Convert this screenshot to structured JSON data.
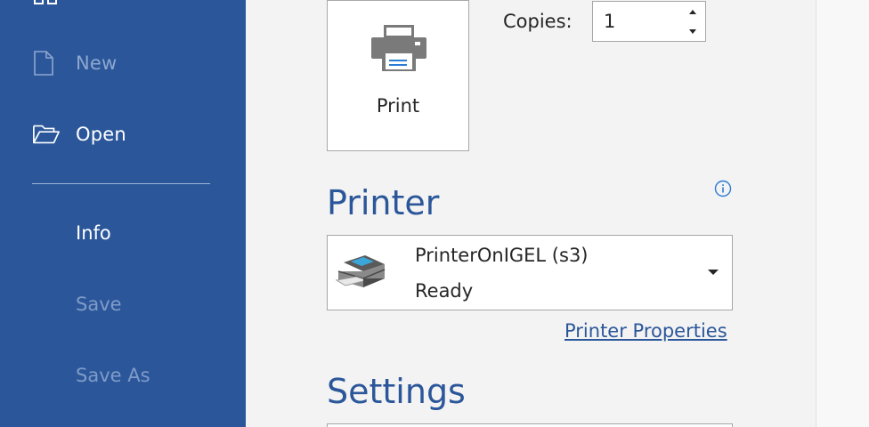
{
  "sidebar": {
    "items": [
      {
        "label": "New",
        "icon": "new-document-icon",
        "enabled": false
      },
      {
        "label": "Open",
        "icon": "folder-open-icon",
        "enabled": true
      },
      {
        "label": "Info",
        "enabled": true
      },
      {
        "label": "Save",
        "enabled": false
      },
      {
        "label": "Save As",
        "enabled": false
      }
    ],
    "bg_color": "#2b579a"
  },
  "print": {
    "button_label": "Print",
    "icon": "printer-icon"
  },
  "copies": {
    "label": "Copies:",
    "value": "1"
  },
  "printer": {
    "section_title": "Printer",
    "selected_name": "PrinterOnIGEL (s3)",
    "selected_status": "Ready",
    "properties_link": "Printer Properties",
    "info_icon": "info-icon"
  },
  "settings": {
    "section_title": "Settings"
  },
  "colors": {
    "accent": "#2b579a",
    "background": "#f3f3f3"
  }
}
